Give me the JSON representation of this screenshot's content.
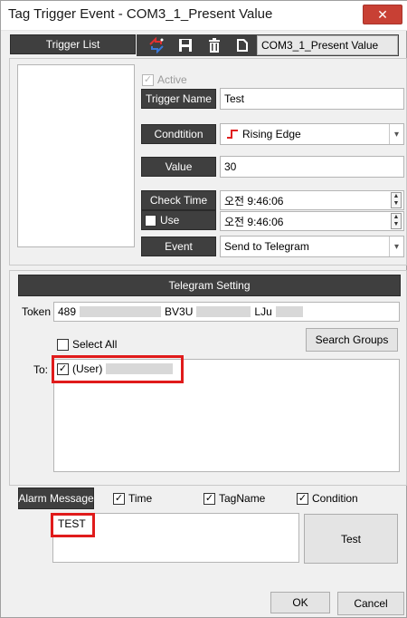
{
  "window": {
    "title": "Tag Trigger Event - COM3_1_Present Value",
    "close": "✕"
  },
  "toolbar": {
    "trigger_list_label": "Trigger List",
    "tag_name_value": "COM3_1_Present Value",
    "icons": [
      "add-trigger-icon",
      "save-icon",
      "delete-icon",
      "new-document-icon"
    ]
  },
  "trigger": {
    "active_label": "Active",
    "name_label": "Trigger Name",
    "name_value": "Test",
    "condition_label": "Condtition",
    "condition_value": "Rising Edge",
    "value_label": "Value",
    "value_value": "30",
    "check_time_label": "Check Time",
    "check_time_1": "오전  9:46:06",
    "use_label": "Use",
    "check_time_2": "오전  9:46:06",
    "event_label": "Event",
    "event_value": "Send to Telegram"
  },
  "telegram": {
    "header": "Telegram Setting",
    "token_label": "Token",
    "token_parts": [
      "489",
      "BV3U",
      "LJu"
    ],
    "select_all_label": "Select All",
    "search_groups_label": "Search Groups",
    "to_label": "To:",
    "recipient_label": "(User)"
  },
  "alarm": {
    "label": "Alarm Message",
    "time_label": "Time",
    "tagname_label": "TagName",
    "condition_label": "Condition",
    "message": "TEST",
    "test_button": "Test"
  },
  "footer": {
    "ok": "OK",
    "cancel": "Cancel"
  },
  "colors": {
    "dark_label": "#3f3f3f",
    "highlight": "#e01b1b",
    "close_button": "#c84034",
    "edge_icon": "#e02020"
  }
}
